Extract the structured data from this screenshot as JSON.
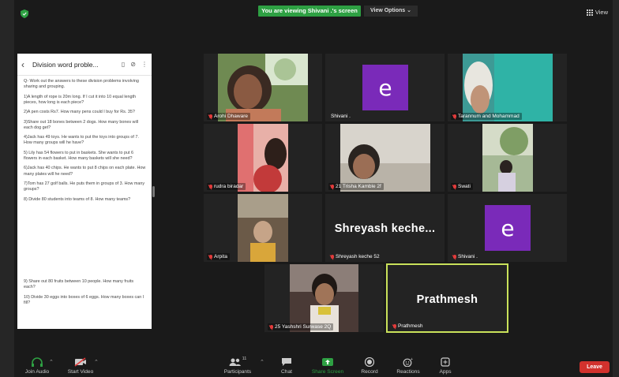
{
  "top_bar": {
    "banner": "You are viewing Shivani .'s screen",
    "view_options": "View Options",
    "view_label": "View"
  },
  "document": {
    "title": "Division word proble...",
    "paragraphs": [
      "Q- Work out the answers to these division problems involving sharing and grouping.",
      "1)A length of rope is 20m long. If I cut it into 10 equal length pieces, how long is each piece?",
      "2)A pen costs Rs7. How many pens could I buy for Rs. 35?",
      "3)Share out 18 bones between 2 dogs. How many bones will each dog get?",
      "4)Jack has 49 toys. He wants to put the toys into groups of 7. How many groups will he have?",
      "5) Lily has 54 flowers to put in baskets. She wants to put 6 flowers in each basket. How many baskets will she need?",
      "6)Jack has 40 chips. He wants to put 8 chips on each plate. How many plates will he need?",
      "7)Tom has 27 golf balls. He puts them in groups of 3. How many groups?",
      "8) Divide 80 students into teams of 8. How many teams?"
    ],
    "paragraphs_cont": [
      "9) Share out 80 fruits between 10 people. How many fruits each?",
      "10) Divide 30 eggs into boxes of 6 eggs. How many boxes can I fill?"
    ]
  },
  "participants": [
    {
      "name": "Arohi Dhaware"
    },
    {
      "name": "Shivani .",
      "initial": "e"
    },
    {
      "name": "Tarannum and Mohammad"
    },
    {
      "name": "rudra biradar"
    },
    {
      "name": "21 Trisha Kamble 2f"
    },
    {
      "name": "Swati"
    },
    {
      "name": "Arpita"
    },
    {
      "name": "Shreyash keche  52",
      "display": "Shreyash keche..."
    },
    {
      "name": "Shivani .",
      "initial": "e"
    },
    {
      "name": "25 Yashshri Surwase 2Q"
    },
    {
      "name": "Prathmesh",
      "display": "Prathmesh"
    }
  ],
  "toolbar": {
    "join_audio": "Join Audio",
    "start_video": "Start Video",
    "participants": "Participants",
    "participants_count": "11",
    "chat": "Chat",
    "share_screen": "Share Screen",
    "record": "Record",
    "reactions": "Reactions",
    "apps": "Apps",
    "leave": "Leave"
  },
  "colors": {
    "banner_green": "#2ea043",
    "avatar_purple": "#7a2ab9",
    "active_speaker": "#c9e15a",
    "leave_red": "#d2322d"
  }
}
